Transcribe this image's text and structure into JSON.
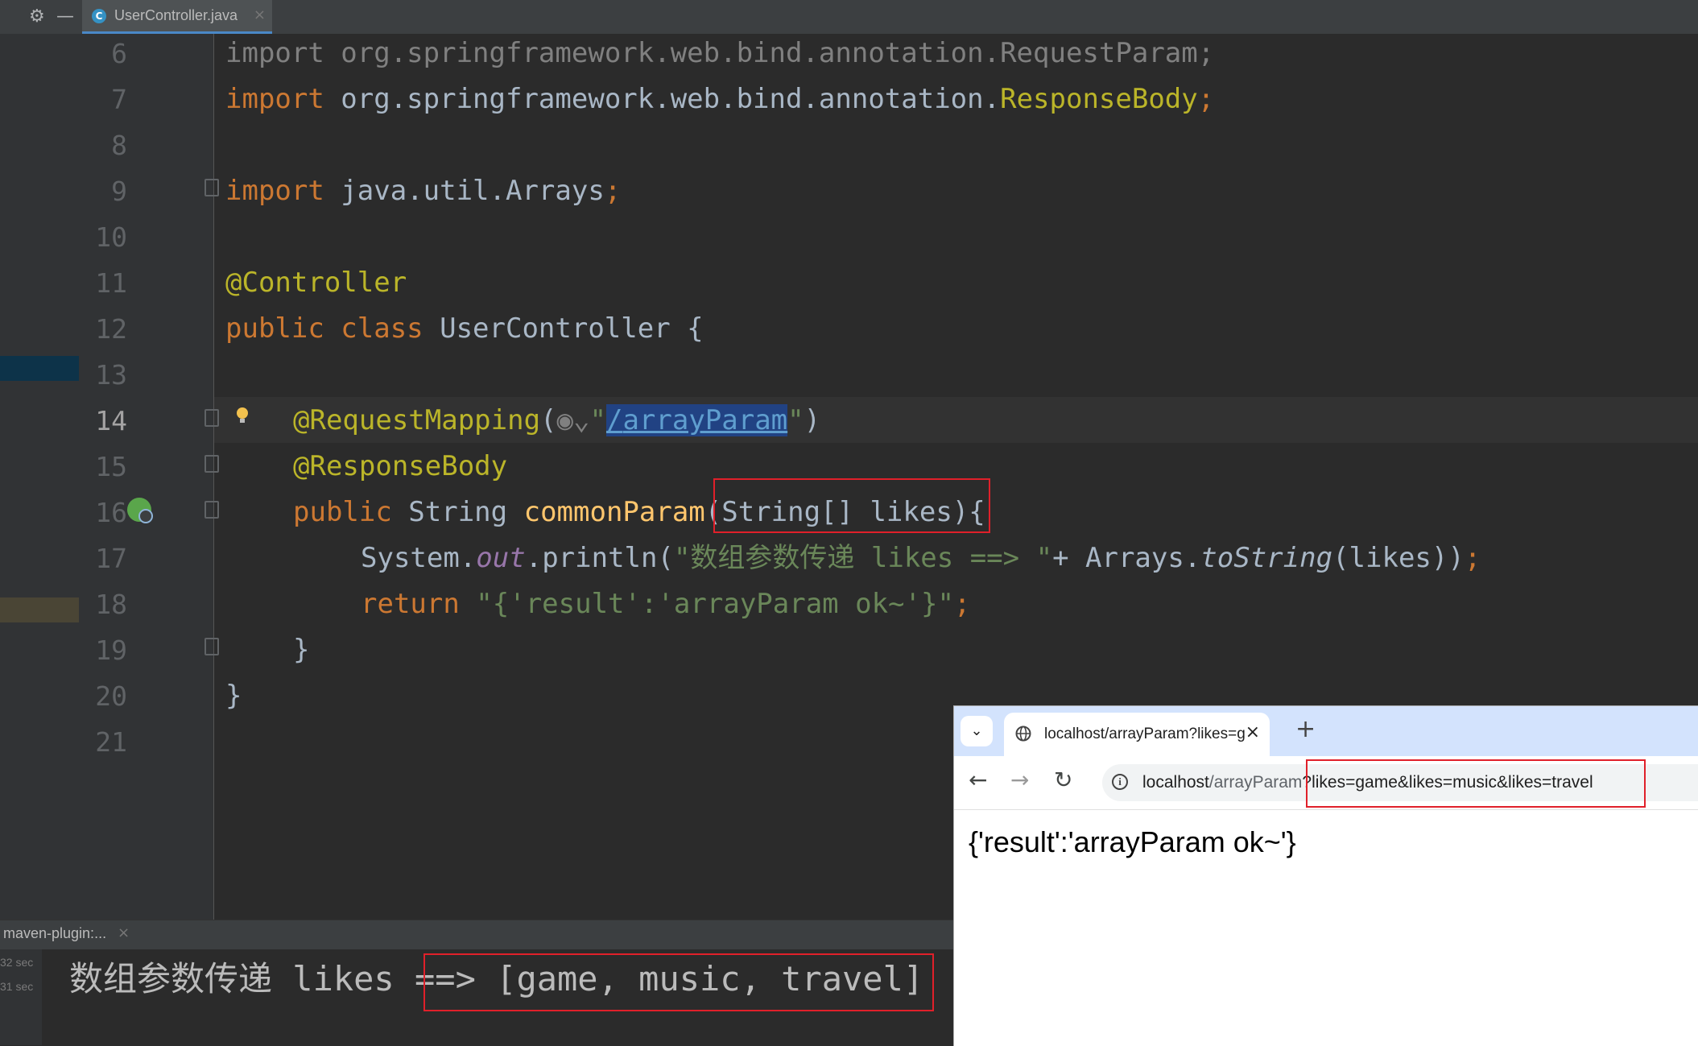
{
  "ide": {
    "tab": {
      "icon_letter": "C",
      "filename": "UserController.java",
      "close": "×"
    },
    "toolbar": {
      "settings_icon": "⚙",
      "minimize_icon": "—"
    },
    "line_numbers": [
      "6",
      "7",
      "8",
      "9",
      "10",
      "11",
      "12",
      "13",
      "14",
      "15",
      "16",
      "17",
      "18",
      "19",
      "20",
      "21"
    ],
    "current_line": "14",
    "code": {
      "l6_kw": "import",
      "l6_rest": " org.springframework.web.bind.annotation.RequestParam;",
      "l7_kw": "import",
      "l7_pkg": " org.springframework.web.bind.annotation.",
      "l7_cls": "ResponseBody",
      "l7_semi": ";",
      "l9_kw": "import",
      "l9_pkg": " java.util.Arrays",
      "l9_semi": ";",
      "l11_ann": "@Controller",
      "l12_kw": "public class",
      "l12_rest": " UserController {",
      "l14_ann": "@RequestMapping",
      "l14_paren": "(",
      "l14_quote_open": "\"",
      "l14_url_slash": "/",
      "l14_url": "arrayParam",
      "l14_quote_close": "\"",
      "l14_end": ")",
      "l15_ann": "@ResponseBody",
      "l16_kw": "public",
      "l16_type": " String ",
      "l16_fn": "commonParam",
      "l16_params": "(String[] likes)",
      "l16_brace": "{",
      "l17_sys": "System.",
      "l17_out": "out",
      "l17_print": ".println(",
      "l17_str": "\"数组参数传递 likes ==> \"",
      "l17_plus": "+ Arrays.",
      "l17_tostr": "toString",
      "l17_end": "(likes))",
      "l17_semi": ";",
      "l18_kw": "return",
      "l18_str": " \"{'result':'arrayParam ok~'}\"",
      "l18_semi": ";",
      "l19": "}",
      "l20": "}"
    }
  },
  "run": {
    "tab_label": "maven-plugin:...",
    "tab_close": "×",
    "times": [
      "32 sec",
      "31 sec"
    ],
    "console_prefix": "数组参数传递 likes ",
    "console_output": "==> [game, music, travel]"
  },
  "browser": {
    "tab_title": "localhost/arrayParam?likes=game&likes=music&likes=travel",
    "tab_close": "×",
    "new_tab": "+",
    "dropdown_icon": "⌄",
    "back_icon": "←",
    "forward_icon": "→",
    "reload_icon": "↻",
    "info_icon": "i",
    "url_host": "localhost",
    "url_path": "/arrayParam",
    "url_query": "?likes=game&likes=music&likes=travel",
    "page_content": "{'result':'arrayParam ok~'}"
  }
}
